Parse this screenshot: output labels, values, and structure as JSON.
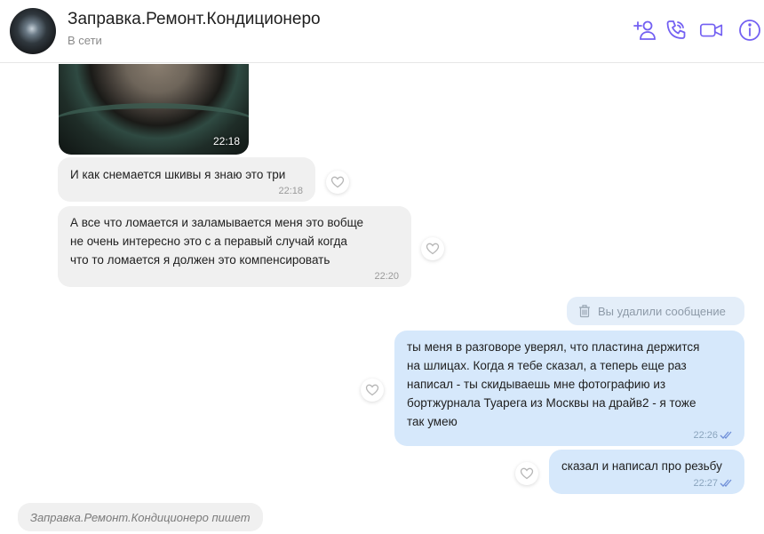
{
  "header": {
    "title": "Заправка.Ремонт.Кондиционеро",
    "status": "В сети",
    "icons": [
      "add-participant-icon",
      "voice-call-icon",
      "video-call-icon",
      "info-icon"
    ],
    "accent_color": "#7360f2"
  },
  "messages": [
    {
      "type": "image",
      "direction": "incoming",
      "time": "22:18"
    },
    {
      "type": "text",
      "direction": "incoming",
      "text": "И как снемается шкивы я знаю это три",
      "time": "22:18"
    },
    {
      "type": "text",
      "direction": "incoming",
      "text": "А все что ломается и заламывается меня это вобще\nне очень интересно это с  а перавый случай когда\nчто то ломается я должен это компенсировать",
      "time": "22:20"
    },
    {
      "type": "deleted",
      "direction": "outgoing",
      "text": "Вы удалили сообщение"
    },
    {
      "type": "text",
      "direction": "outgoing",
      "text": "ты меня в разговоре уверял, что пластина держится\nна шлицах. Когда я тебе сказал, а теперь еще раз\nнаписал - ты скидываешь мне фотографию из\nбортжурнала Туарега из Москвы на драйв2 - я тоже\nтак умею",
      "time": "22:26",
      "read": true
    },
    {
      "type": "text",
      "direction": "outgoing",
      "text": "сказал и написал про резьбу",
      "time": "22:27",
      "read": true
    }
  ],
  "typing_indicator": "Заправка.Ремонт.Кондиционеро пишет",
  "colors": {
    "incoming_bubble": "#f0f0f0",
    "outgoing_bubble": "#d6e8fb",
    "read_ticks": "#6f8fd8"
  }
}
